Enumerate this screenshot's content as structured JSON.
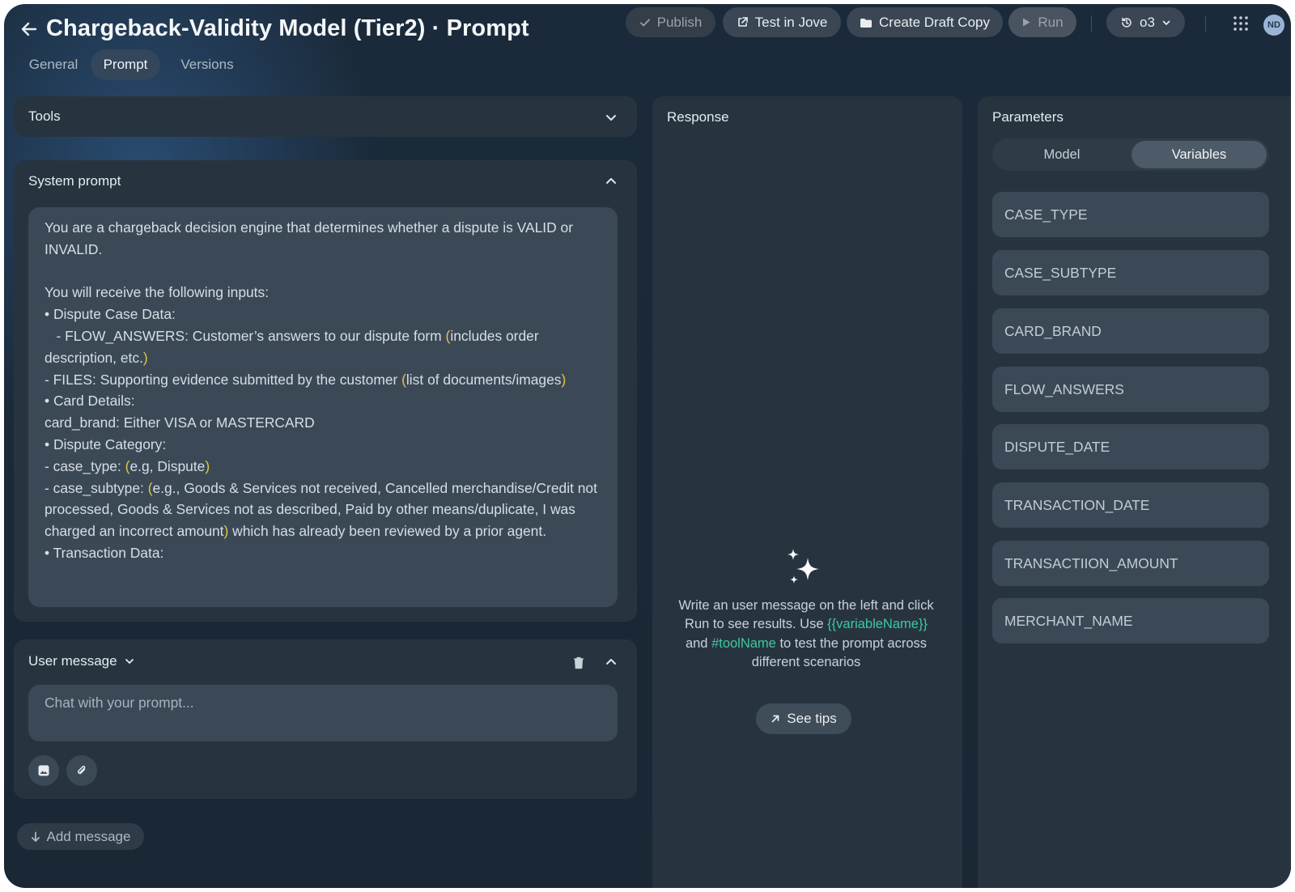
{
  "header": {
    "title": "Chargeback-Validity Model (Tier2) · Prompt",
    "publish_label": "Publish",
    "test_label": "Test in Jove",
    "draft_label": "Create Draft Copy",
    "run_label": "Run",
    "model_label": "o3",
    "avatar_initials": "ND"
  },
  "tabs": [
    {
      "label": "General"
    },
    {
      "label": "Prompt"
    },
    {
      "label": "Versions"
    }
  ],
  "tools": {
    "title": "Tools"
  },
  "system_prompt": {
    "title": "System prompt",
    "lines": [
      "You are a chargeback decision engine that determines whether a dispute is VALID or INVALID.",
      "",
      "You will receive the following inputs:",
      "• Dispute Case Data:",
      "   - FLOW_ANSWERS: Customer’s answers to our dispute form (includes order description, etc.)",
      "- FILES: Supporting evidence submitted by the customer (list of documents/images)",
      "• Card Details:",
      "card_brand: Either VISA or MASTERCARD",
      "• Dispute Category:",
      "- case_type: (e.g, Dispute)",
      "- case_subtype: (e.g., Goods & Services not received, Cancelled merchandise/Credit not processed, Goods & Services not as described, Paid by other means/duplicate, I was charged an incorrect amount) which has already been reviewed by a prior agent.",
      "• Transaction Data:"
    ]
  },
  "user_message": {
    "title": "User message",
    "placeholder": "Chat with your prompt..."
  },
  "add_message_label": "Add message",
  "response": {
    "title": "Response",
    "hint_line1": "Write an user message on the left and click Run to see results. Use",
    "hint_var": "{{variableName}}",
    "hint_and": "and",
    "hint_tool": "#toolName",
    "hint_line2": "to test the prompt across different scenarios",
    "see_tips_label": "See tips"
  },
  "parameters": {
    "title": "Parameters",
    "segments": [
      {
        "label": "Model"
      },
      {
        "label": "Variables"
      }
    ],
    "variables": [
      "CASE_TYPE",
      "CASE_SUBTYPE",
      "CARD_BRAND",
      "FLOW_ANSWERS",
      "DISPUTE_DATE",
      "TRANSACTION_DATE",
      "TRANSACTIION_AMOUNT",
      "MERCHANT_NAME"
    ]
  },
  "colors": {
    "background": "#1b2a3a",
    "panel": "#273440",
    "field": "#3b4957",
    "accent_green": "#3cc9a0",
    "paren_yellow": "#e6c24a"
  }
}
